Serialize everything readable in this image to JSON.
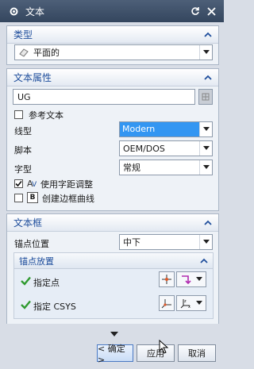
{
  "window": {
    "title": "文本"
  },
  "type_section": {
    "title": "类型",
    "type_value": "平面的"
  },
  "text_props": {
    "title": "文本属性",
    "text_value": "UG",
    "reference_text_label": "参考文本",
    "line_type_label": "线型",
    "line_type_value": "Modern",
    "script_label": "脚本",
    "script_value": "OEM/DOS",
    "font_style_label": "字型",
    "font_style_value": "常规",
    "kerning_label": "使用字距调整",
    "border_curve_label": "创建边框曲线"
  },
  "text_frame": {
    "title": "文本框",
    "anchor_pos_label": "锚点位置",
    "anchor_pos_value": "中下",
    "anchor_placement": {
      "title": "锚点放置",
      "specify_point_label": "指定点",
      "specify_csys_label": "指定 CSYS"
    }
  },
  "buttons": {
    "ok": "< 确定 >",
    "apply": "应用",
    "cancel": "取消"
  },
  "colors": {
    "accent": "#1f4e9c",
    "selection": "#3396f2",
    "check": "#2f9a2f"
  }
}
